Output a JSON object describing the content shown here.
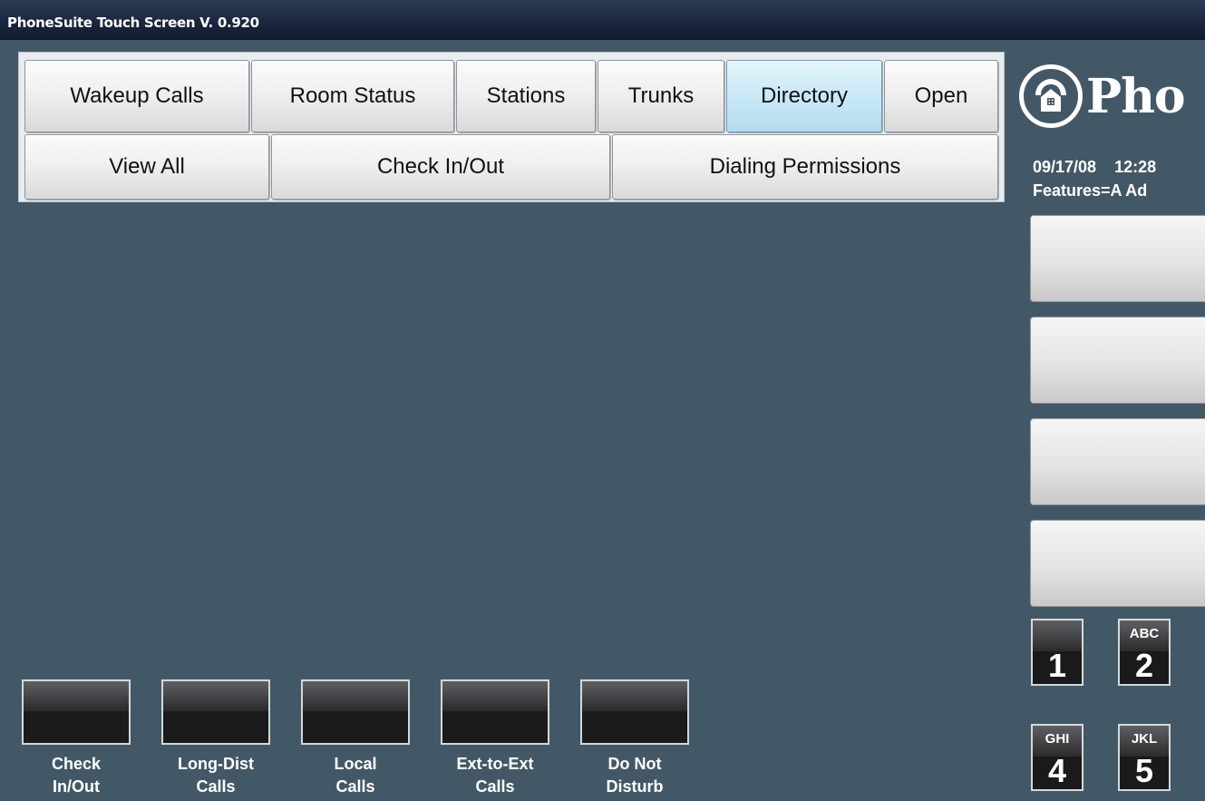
{
  "window": {
    "title": "PhoneSuite Touch Screen V. 0.920"
  },
  "tabs": {
    "row1": [
      {
        "label": "Wakeup Calls",
        "selected": false
      },
      {
        "label": "Room Status",
        "selected": false
      },
      {
        "label": "Stations",
        "selected": false
      },
      {
        "label": "Trunks",
        "selected": false
      },
      {
        "label": "Directory",
        "selected": true
      },
      {
        "label": "Open",
        "selected": false
      }
    ],
    "row2": [
      {
        "label": "View All"
      },
      {
        "label": "Check In/Out"
      },
      {
        "label": "Dialing Permissions"
      }
    ]
  },
  "right_panel": {
    "logo_text": "Pho",
    "date": "09/17/08",
    "time": "12:28",
    "features": "Features=A Ad",
    "keypad": [
      {
        "letters": "",
        "digit": "1"
      },
      {
        "letters": "ABC",
        "digit": "2"
      },
      {
        "letters": "GHI",
        "digit": "4"
      },
      {
        "letters": "JKL",
        "digit": "5"
      }
    ]
  },
  "feature_buttons": [
    {
      "line1": "Check",
      "line2": "In/Out"
    },
    {
      "line1": "Long-Dist",
      "line2": "Calls"
    },
    {
      "line1": "Local",
      "line2": "Calls"
    },
    {
      "line1": "Ext-to-Ext",
      "line2": "Calls"
    },
    {
      "line1": "Do Not",
      "line2": "Disturb"
    }
  ],
  "colors": {
    "background": "#435866",
    "titlebar": "#1b2740",
    "selected_tab": "#c9e8f6"
  }
}
